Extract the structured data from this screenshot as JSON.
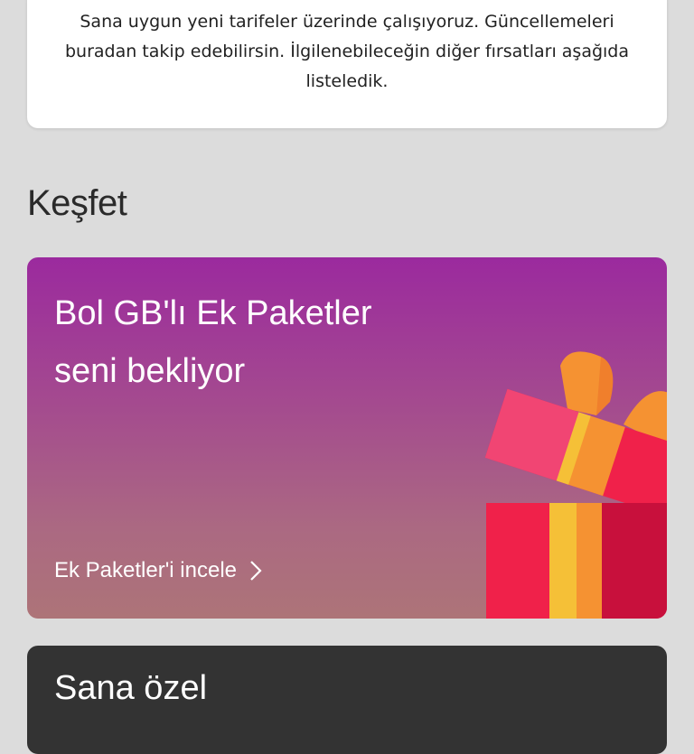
{
  "info_card": {
    "lines": [
      "Sana uygun yeni tarifeler üzerinde çalışıyoruz. Güncellemeleri",
      "buradan takip edebilirsin. İlgilenebileceğin diğer fırsatları aşağıda",
      "listeledik."
    ]
  },
  "discover": {
    "title": "Keşfet"
  },
  "promo": {
    "title_line1": "Bol GB'lı Ek Paketler",
    "title_line2": "seni bekliyor",
    "link_label": "Ek Paketler'i incele",
    "link_icon": "chevron-right-icon",
    "illustration_icon": "gift-icon",
    "colors": {
      "gradient_top": "#9b2a9e",
      "gradient_bottom": "#ad7478",
      "gift_red": "#f0214a",
      "gift_dark_red": "#c8103c",
      "gift_orange": "#f59232",
      "gift_yellow": "#f5c037",
      "gift_pink": "#f14573"
    }
  },
  "special": {
    "title": "Sana özel"
  }
}
